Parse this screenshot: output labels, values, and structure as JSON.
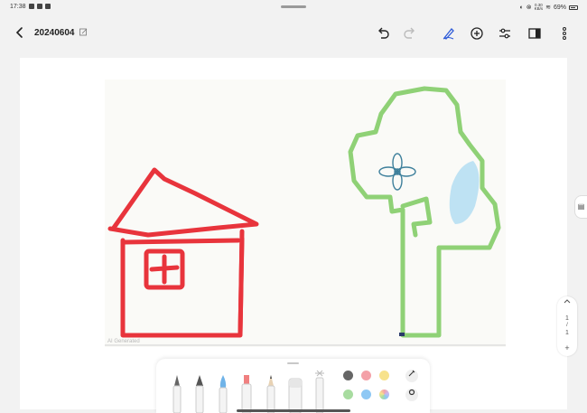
{
  "status_bar": {
    "time": "17:38",
    "net_speed_value": "0.30",
    "net_speed_unit": "KB/s",
    "battery": "69%"
  },
  "header": {
    "title": "20240604"
  },
  "pager": {
    "current": "1",
    "separator": "/",
    "total": "1",
    "add_label": "+"
  },
  "watermark": {
    "text": "AI Generated"
  },
  "pen_tools": [
    {
      "name": "fountain-pen",
      "accent": "#666666"
    },
    {
      "name": "calligraphy-pen",
      "accent": "#555555"
    },
    {
      "name": "watercolor-brush",
      "accent": "#6fb3e8"
    },
    {
      "name": "highlighter",
      "accent": "#f08080"
    },
    {
      "name": "pencil",
      "accent": "#444444"
    },
    {
      "name": "eraser",
      "accent": "#dddddd"
    },
    {
      "name": "spray-brush",
      "accent": "#bbbbbb"
    }
  ],
  "colors": {
    "row1": [
      "#666666",
      "#f4a1a8",
      "#f7e28c"
    ],
    "row2": [
      "#a8dca0",
      "#8ec8f4",
      "#c7b8f0"
    ]
  },
  "theme": {
    "house_red": "#e8343c",
    "tree_green": "#8fd176",
    "flower_blue": "#3d7f9b",
    "accent_blue": "#2e5bd8"
  }
}
